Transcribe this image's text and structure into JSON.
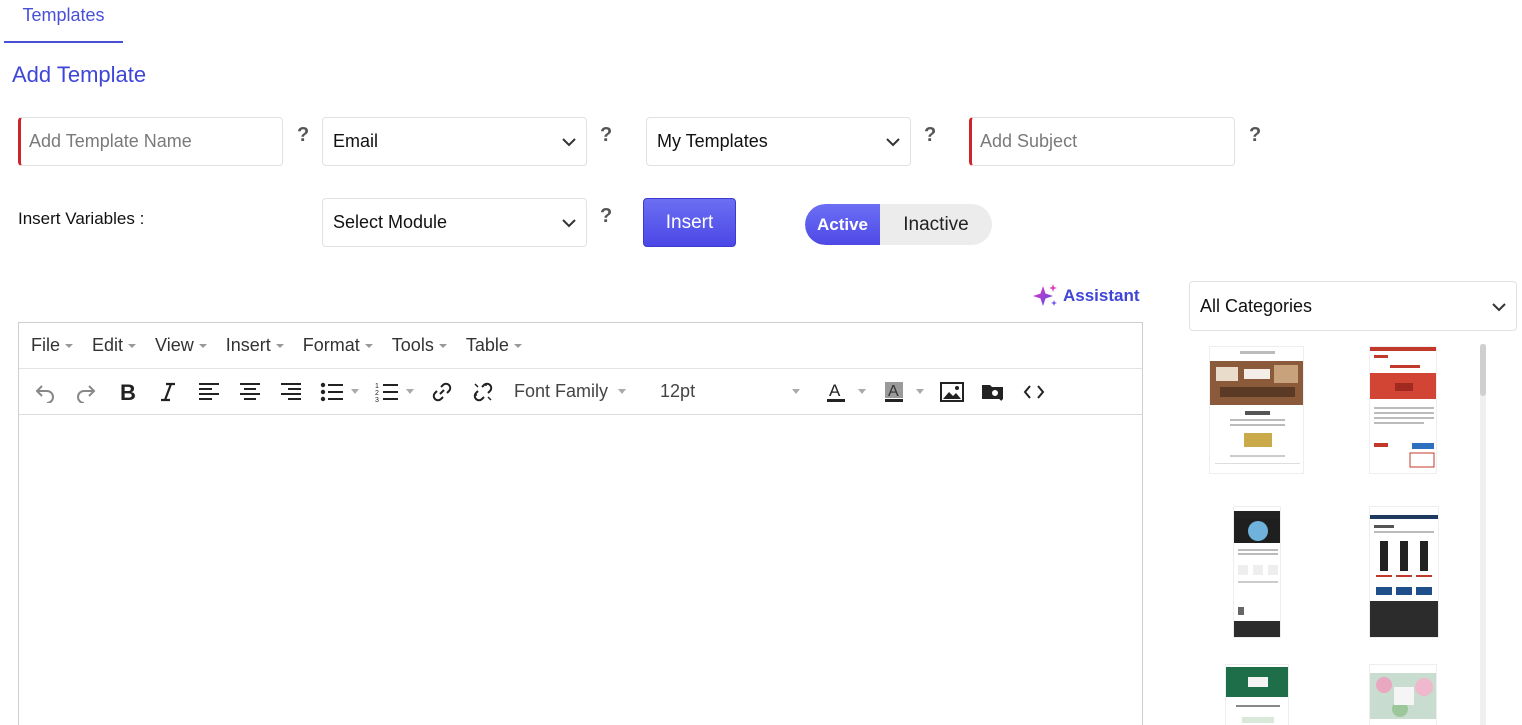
{
  "tabs": [
    {
      "label": "Templates"
    }
  ],
  "page_title": "Add Template",
  "form": {
    "template_name_placeholder": "Add Template Name",
    "channel_value": "Email",
    "folder_value": "My Templates",
    "subject_placeholder": "Add Subject",
    "help_glyph": "?"
  },
  "variables": {
    "label": "Insert Variables :",
    "module_value": "Select Module",
    "insert_label": "Insert"
  },
  "status_toggle": {
    "active_label": "Active",
    "inactive_label": "Inactive",
    "selected": "Active"
  },
  "assistant_label": "Assistant",
  "editor": {
    "menus": [
      "File",
      "Edit",
      "View",
      "Insert",
      "Format",
      "Tools",
      "Table"
    ],
    "font_family_label": "Font Family",
    "font_size_value": "12pt",
    "content": ""
  },
  "categories": {
    "selected": "All Categories"
  },
  "colors": {
    "accent": "#4a4fd8",
    "required": "#d0242b"
  }
}
